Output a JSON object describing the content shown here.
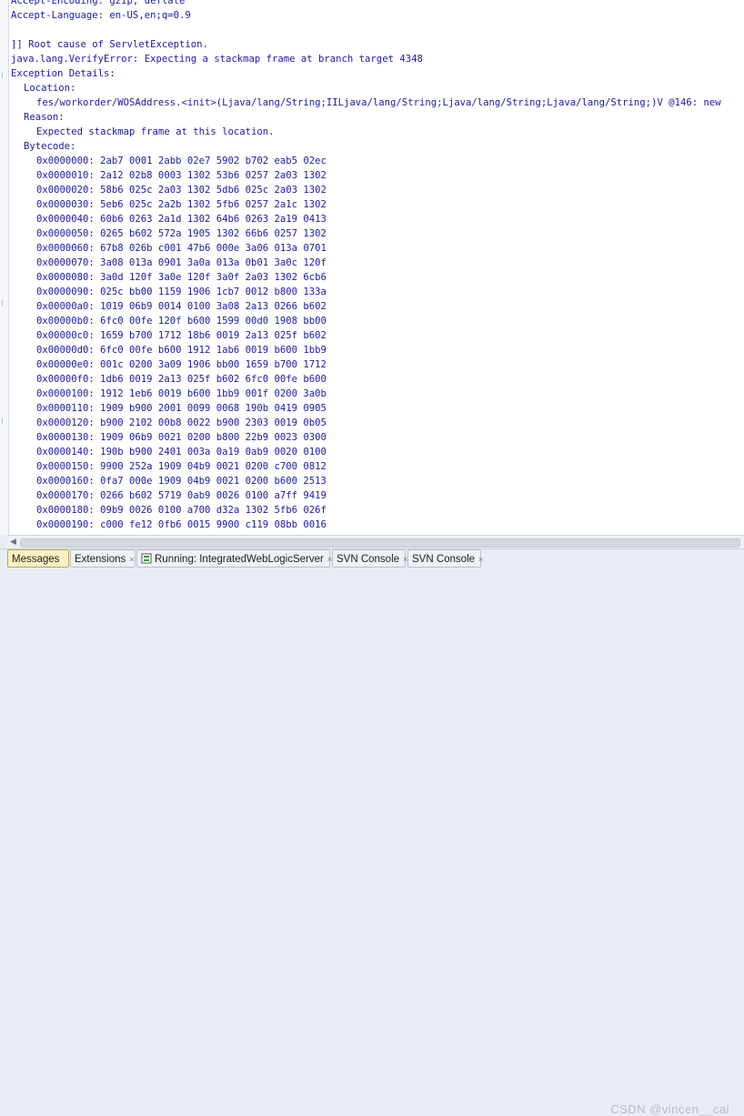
{
  "console": {
    "header_lines": [
      "Accept-Encoding: gzip, deflate",
      "Accept-Language: en-US,en;q=0.9"
    ],
    "root_cause": "]] Root cause of ServletException.",
    "error": "java.lang.VerifyError: Expecting a stackmap frame at branch target 4348",
    "exception_details": "Exception Details:",
    "location_label": "Location:",
    "location_value": "fes/workorder/WOSAddress.<init>(Ljava/lang/String;IILjava/lang/String;Ljava/lang/String;Ljava/lang/String;)V @146: new",
    "reason_label": "Reason:",
    "reason_value": "Expected stackmap frame at this location.",
    "bytecode_label": "Bytecode:",
    "bytecode": [
      "0x0000000: 2ab7 0001 2abb 02e7 5902 b702 eab5 02ec",
      "0x0000010: 2a12 02b8 0003 1302 53b6 0257 2a03 1302",
      "0x0000020: 58b6 025c 2a03 1302 5db6 025c 2a03 1302",
      "0x0000030: 5eb6 025c 2a2b 1302 5fb6 0257 2a1c 1302",
      "0x0000040: 60b6 0263 2a1d 1302 64b6 0263 2a19 0413",
      "0x0000050: 0265 b602 572a 1905 1302 66b6 0257 1302",
      "0x0000060: 67b8 026b c001 47b6 000e 3a06 013a 0701",
      "0x0000070: 3a08 013a 0901 3a0a 013a 0b01 3a0c 120f",
      "0x0000080: 3a0d 120f 3a0e 120f 3a0f 2a03 1302 6cb6",
      "0x0000090: 025c bb00 1159 1906 1cb7 0012 b800 133a",
      "0x00000a0: 1019 06b9 0014 0100 3a08 2a13 0266 b602",
      "0x00000b0: 6fc0 00fe 120f b600 1599 00d0 1908 bb00",
      "0x00000c0: 1659 b700 1712 18b6 0019 2a13 025f b602",
      "0x00000d0: 6fc0 00fe b600 1912 1ab6 0019 b600 1bb9",
      "0x00000e0: 001c 0200 3a09 1906 bb00 1659 b700 1712",
      "0x00000f0: 1db6 0019 2a13 025f b602 6fc0 00fe b600",
      "0x0000100: 1912 1eb6 0019 b600 1bb9 001f 0200 3a0b",
      "0x0000110: 1909 b900 2001 0099 0068 190b 0419 0905",
      "0x0000120: b900 2102 00b8 0022 b900 2303 0019 0b05",
      "0x0000130: 1909 06b9 0021 0200 b800 22b9 0023 0300",
      "0x0000140: 190b b900 2401 003a 0a19 0ab9 0020 0100",
      "0x0000150: 9900 252a 1909 04b9 0021 0200 c700 0812",
      "0x0000160: 0fa7 000e 1909 04b9 0021 0200 b600 2513",
      "0x0000170: 0266 b602 5719 0ab9 0026 0100 a7ff 9419",
      "0x0000180: 09b9 0026 0100 a700 d32a 1302 5fb6 026f",
      "0x0000190: c000 fe12 0fb6 0015 9900 c119 08bb 0016"
    ]
  },
  "tabs": [
    {
      "label": "Messages",
      "closable": false,
      "active": true
    },
    {
      "label": "Extensions",
      "closable": true,
      "active": false
    },
    {
      "label": "Running: IntegratedWebLogicServer",
      "closable": true,
      "active": false,
      "icon": "server-running-icon"
    },
    {
      "label": "SVN Console",
      "closable": true,
      "active": false
    },
    {
      "label": "SVN Console",
      "closable": true,
      "active": false
    }
  ],
  "watermark": "CSDN @vincen__cai",
  "colors": {
    "console_text": "#1a1aa6",
    "active_tab": "#fbf1c2",
    "background": "#ffffff"
  }
}
